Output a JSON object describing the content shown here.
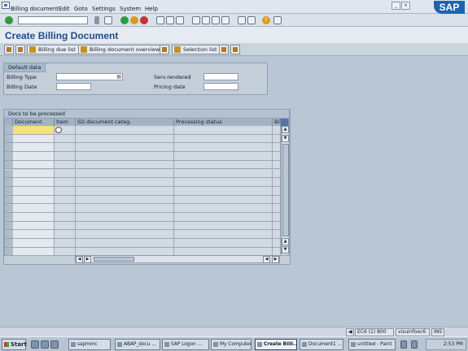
{
  "menu": [
    "Billing document",
    "Edit",
    "Goto",
    "Settings",
    "System",
    "Help"
  ],
  "logo_text": "SAP",
  "title": "Create Billing Document",
  "app_toolbar": {
    "billing_due_list": "Billing due list",
    "billing_doc_overview": "Billing document overview",
    "selection_list": "Selection list"
  },
  "default_data": {
    "title": "Default data",
    "billing_type_label": "Billing Type",
    "billing_date_label": "Billing Date",
    "serv_rendered_label": "Serv.rendered",
    "pricing_date_label": "Pricing date"
  },
  "table": {
    "title": "Docs to be processed",
    "columns": [
      "Document",
      "Item",
      "SD document categ.",
      "Processing status",
      "Billi"
    ]
  },
  "status": {
    "system": "EC6 (1) 800",
    "server": "visuinfoec6",
    "mode": "INS"
  },
  "taskbar": {
    "start": "Start",
    "items": [
      "sapmmc",
      "ABAP_docu ...",
      "SAP Logon ...",
      "My Computer",
      "Create Billi...",
      "Document1 ...",
      "untitled - Paint"
    ],
    "clock": "2:53 PM"
  },
  "icons": [
    "window-icon",
    "enter-icon",
    "save-icon",
    "back-icon",
    "exit-icon",
    "cancel-icon",
    "help-icon"
  ]
}
